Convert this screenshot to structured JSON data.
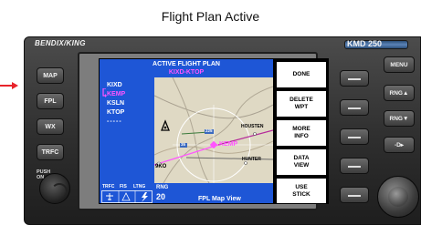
{
  "caption": "Flight Plan Active",
  "device": {
    "brand": "BENDIX/KING",
    "model": "KMD 250"
  },
  "left_buttons": [
    {
      "label": "MAP"
    },
    {
      "label": "FPL"
    },
    {
      "label": "WX"
    },
    {
      "label": "TRFC"
    }
  ],
  "push_on_label": "PUSH ON",
  "screen": {
    "title": "ACTIVE FLIGHT PLAN",
    "route": "KIXD-KTOP",
    "waypoints": [
      {
        "id": "KIXD",
        "active": false
      },
      {
        "id": "KEMP",
        "active": true
      },
      {
        "id": "KSLN",
        "active": false
      },
      {
        "id": "KTOP",
        "active": false
      }
    ],
    "empty_slot": "-----",
    "map_labels": {
      "kemp": "KEMP",
      "ixd": "9KO",
      "hdr": "HOUSTEN",
      "bnd": "HUNTER",
      "rt_num": "225",
      "rt_num2": "35"
    },
    "status": {
      "trfc": "TRFC",
      "fis": "FIS",
      "ltng": "LTNG"
    },
    "range_label": "RNG",
    "range_value": "20",
    "view_label": "FPL Map View",
    "softkeys": [
      {
        "line1": "DONE",
        "line2": ""
      },
      {
        "line1": "DELETE",
        "line2": "WPT"
      },
      {
        "line1": "MORE",
        "line2": "INFO"
      },
      {
        "line1": "DATA",
        "line2": "VIEW"
      },
      {
        "line1": "USE",
        "line2": "STICK"
      }
    ]
  },
  "function_buttons": [
    {
      "label": "MENU"
    },
    {
      "label": "RNG▲"
    },
    {
      "label": "RNG▼"
    },
    {
      "label": "-D▸"
    }
  ],
  "colors": {
    "screen_blue": "#1e56d6",
    "active_magenta": "#ff55ff",
    "arrow_red": "#e8232a"
  }
}
